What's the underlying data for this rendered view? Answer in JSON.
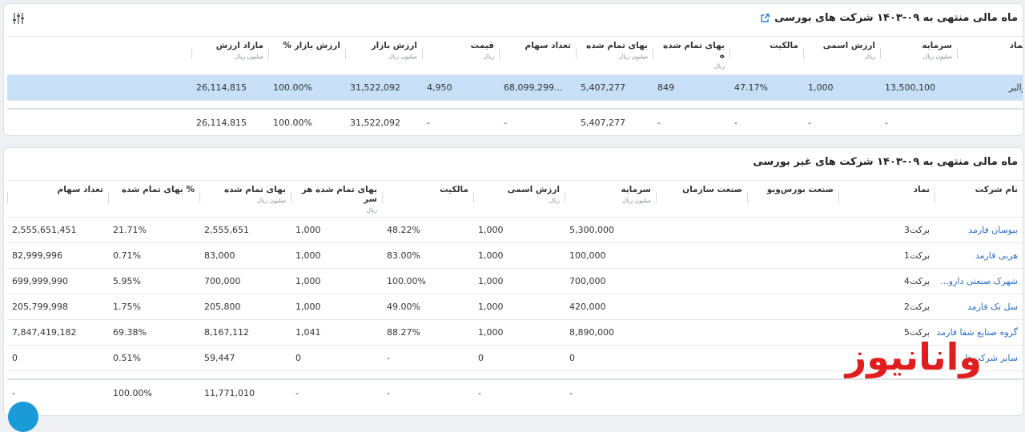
{
  "listed": {
    "title": "ماه مالی منتهی به ۰۹-۱۴۰۳ شرکت های بورسی",
    "columns": [
      {
        "label": "نماد",
        "unit": ""
      },
      {
        "label": "سرمایه",
        "unit": "میلیون ریال"
      },
      {
        "label": "ارزش اسمی",
        "unit": "ریال"
      },
      {
        "label": "مالکیت",
        "unit": ""
      },
      {
        "label": "بهای تمام شده ه",
        "unit": "ریال"
      },
      {
        "label": "بهای تمام شده",
        "unit": "میلیون ریال"
      },
      {
        "label": "تعداد سهام",
        "unit": ""
      },
      {
        "label": "قیمت",
        "unit": "ریال"
      },
      {
        "label": "ارزش بازار",
        "unit": "میلیون ریال"
      },
      {
        "label": "ارزش بازار %",
        "unit": ""
      },
      {
        "label": "مازاد ارزش",
        "unit": "میلیون ریال"
      },
      {
        "label": "",
        "unit": ""
      }
    ],
    "rows": [
      [
        "والبر",
        "13,500,100",
        "1,000",
        "47.17%",
        "849",
        "5,407,277",
        "...68,099,299",
        "4,950",
        "31,522,092",
        "100.00%",
        "26,114,815",
        ""
      ]
    ],
    "total": [
      "",
      "-",
      "-",
      "-",
      "-",
      "5,407,277",
      "-",
      "-",
      "31,522,092",
      "100.00%",
      "26,114,815",
      ""
    ]
  },
  "unlisted": {
    "title": "ماه مالی منتهی به ۰۹-۱۴۰۳ شرکت های غیر بورسی",
    "columns": [
      {
        "label": "نام شرکت",
        "unit": ""
      },
      {
        "label": "نماد",
        "unit": ""
      },
      {
        "label": "صنعت بورس‌ویو",
        "unit": ""
      },
      {
        "label": "صنعت سازمان",
        "unit": ""
      },
      {
        "label": "سرمایه",
        "unit": "میلیون ریال"
      },
      {
        "label": "ارزش اسمی",
        "unit": "ریال"
      },
      {
        "label": "مالکیت",
        "unit": ""
      },
      {
        "label": "بهای تمام شده هر سر",
        "unit": "ریال"
      },
      {
        "label": "بهای تمام شده",
        "unit": "میلیون ریال"
      },
      {
        "label": "% بهای تمام شده",
        "unit": ""
      },
      {
        "label": "تعداد سهام",
        "unit": ""
      }
    ],
    "rows": [
      [
        "بیوسان فارمد",
        "برکت3",
        "",
        "",
        "5,300,000",
        "1,000",
        "48.22%",
        "1,000",
        "2,555,651",
        "21.71%",
        "2,555,651,451"
      ],
      [
        "هربی فارمد",
        "برکت1",
        "",
        "",
        "100,000",
        "1,000",
        "83.00%",
        "1,000",
        "83,000",
        "0.71%",
        "82,999,996"
      ],
      [
        "شهرک صنعتی دارو...",
        "برکت4",
        "",
        "",
        "700,000",
        "1,000",
        "100.00%",
        "1,000",
        "700,000",
        "5.95%",
        "699,999,990"
      ],
      [
        "سل تک فارمد",
        "برکت2",
        "",
        "",
        "420,000",
        "1,000",
        "49.00%",
        "1,000",
        "205,800",
        "1.75%",
        "205,799,998"
      ],
      [
        "گروه صنایع شفا فارمد",
        "برکت5",
        "",
        "",
        "8,890,000",
        "1,000",
        "88.27%",
        "1,041",
        "8,167,112",
        "69.38%",
        "7,847,419,182"
      ],
      [
        "سایر شرکت‌ها",
        "",
        "",
        "",
        "0",
        "0",
        "-",
        "0",
        "59,447",
        "0.51%",
        "0"
      ]
    ],
    "total": [
      "",
      "",
      "",
      "",
      "-",
      "-",
      "-",
      "-",
      "11,771,010",
      "100.00%",
      "-"
    ]
  },
  "watermark": "وانانیوز",
  "colors": {
    "selected_row": "#c7e0f8",
    "link": "#2a6fc9",
    "watermark": "#e01e1e",
    "chat": "#1a9ad6"
  }
}
